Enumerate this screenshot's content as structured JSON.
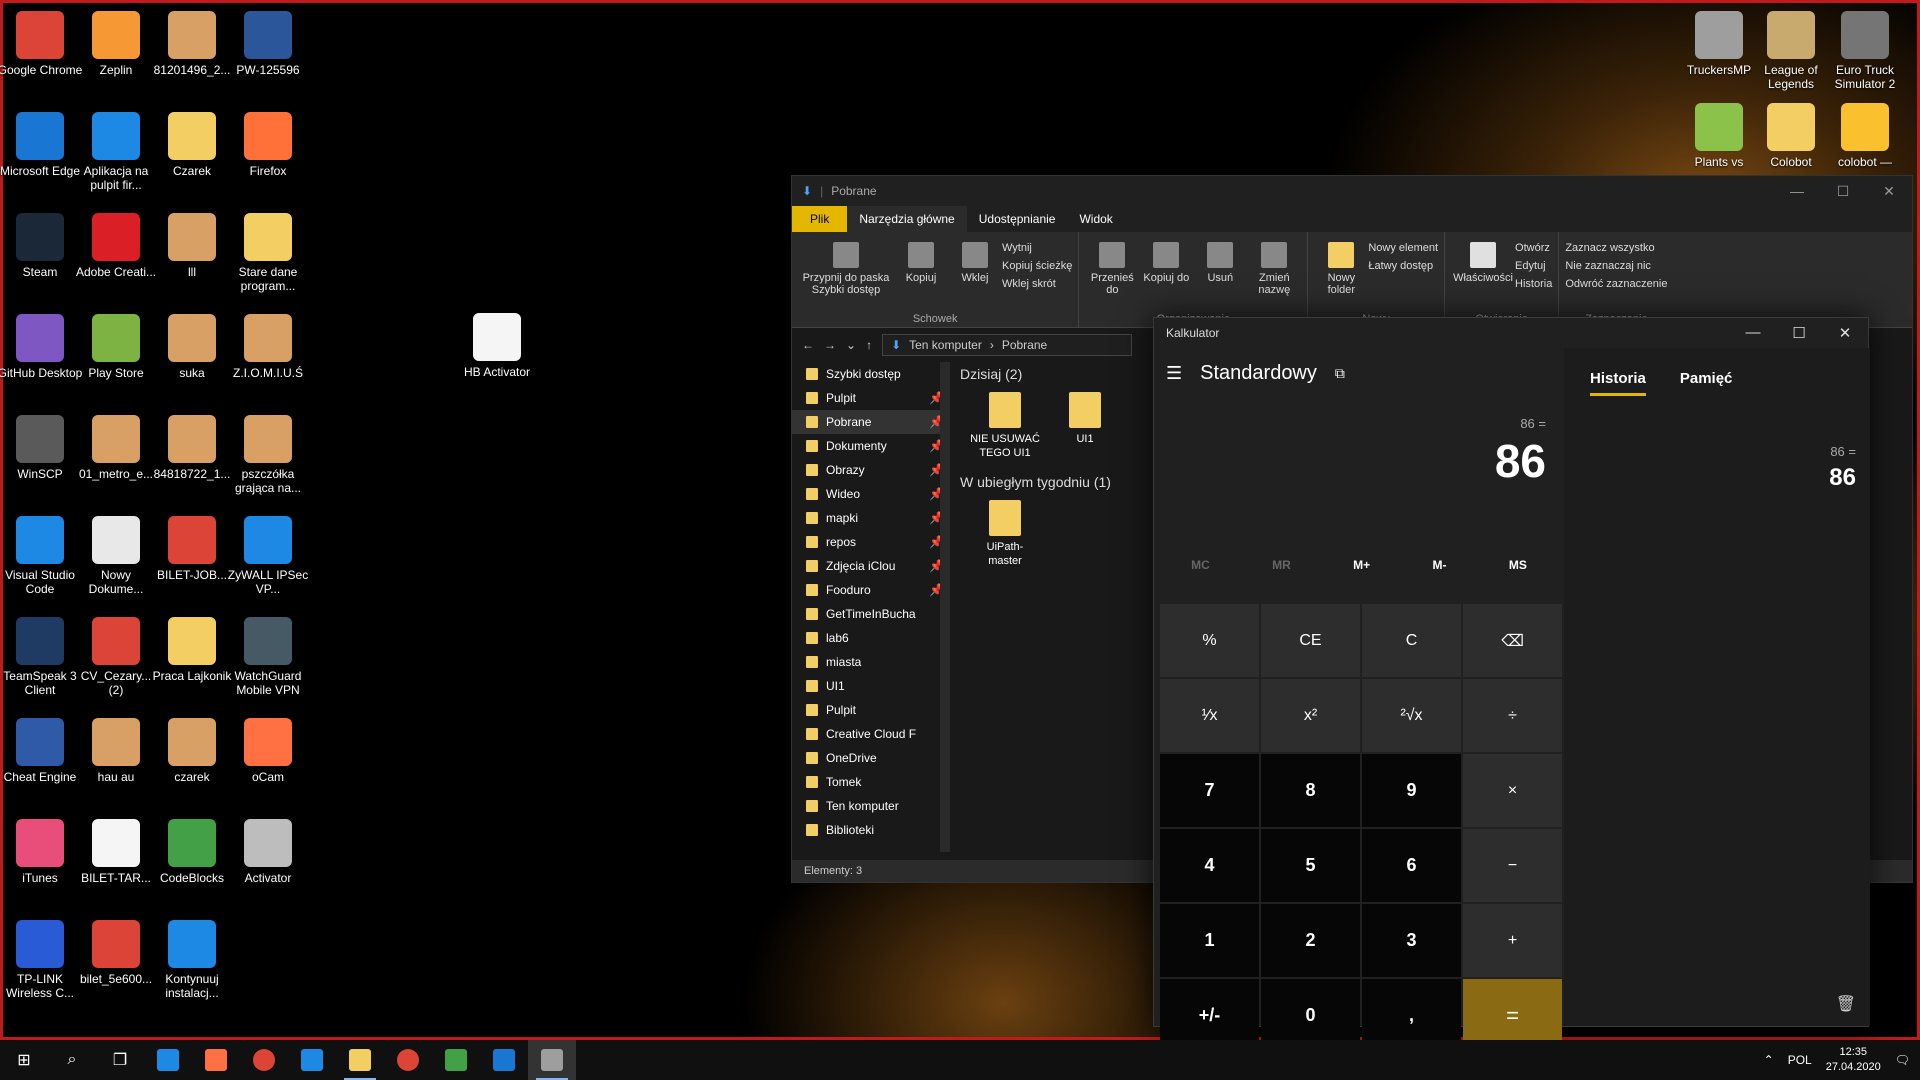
{
  "desktop": {
    "icons": [
      {
        "label": "Google Chrome",
        "icon": "chrome-icon",
        "color": "#db4437"
      },
      {
        "label": "Microsoft Edge",
        "icon": "edge-icon",
        "color": "#1976d2"
      },
      {
        "label": "Steam",
        "icon": "steam-icon",
        "color": "#1b2838"
      },
      {
        "label": "GitHub Desktop",
        "icon": "github-icon",
        "color": "#7e57c2"
      },
      {
        "label": "WinSCP",
        "icon": "winscp-icon",
        "color": "#5a5a5a"
      },
      {
        "label": "Visual Studio Code",
        "icon": "vscode-icon",
        "color": "#1e88e5"
      },
      {
        "label": "TeamSpeak 3 Client",
        "icon": "teamspeak-icon",
        "color": "#1f3b63"
      },
      {
        "label": "Cheat Engine",
        "icon": "cheatengine-icon",
        "color": "#2e5aa8"
      },
      {
        "label": "iTunes",
        "icon": "itunes-icon",
        "color": "#e94d7a"
      },
      {
        "label": "TP-LINK Wireless C...",
        "icon": "tplink-icon",
        "color": "#2a5bd7"
      },
      {
        "label": "Zeplin",
        "icon": "zeplin-icon",
        "color": "#f69833"
      },
      {
        "label": "Aplikacja na pulpit fir...",
        "icon": "app-icon",
        "color": "#1e88e5"
      },
      {
        "label": "Adobe Creati...",
        "icon": "adobe-icon",
        "color": "#da1f26"
      },
      {
        "label": "Play Store",
        "icon": "playstore-icon",
        "color": "#7cb342"
      },
      {
        "label": "01_metro_e...",
        "icon": "image-icon",
        "color": "#d9a066"
      },
      {
        "label": "Nowy Dokume...",
        "icon": "document-icon",
        "color": "#e8e8e8"
      },
      {
        "label": "CV_Cezary... (2)",
        "icon": "chrome-icon",
        "color": "#db4437"
      },
      {
        "label": "hau au",
        "icon": "image-icon",
        "color": "#d9a066"
      },
      {
        "label": "BILET-TAR...",
        "icon": "file-icon",
        "color": "#f5f5f5"
      },
      {
        "label": "bilet_5e600...",
        "icon": "chrome-icon",
        "color": "#db4437"
      },
      {
        "label": "81201496_2...",
        "icon": "image-icon",
        "color": "#d9a066"
      },
      {
        "label": "Czarek",
        "icon": "folder-icon",
        "color": "#f3cf63"
      },
      {
        "label": "lll",
        "icon": "image-icon",
        "color": "#d9a066"
      },
      {
        "label": "suka",
        "icon": "image-icon",
        "color": "#d9a066"
      },
      {
        "label": "84818722_1...",
        "icon": "image-icon",
        "color": "#d9a066"
      },
      {
        "label": "BILET-JOB...",
        "icon": "chrome-icon",
        "color": "#db4437"
      },
      {
        "label": "Praca Lajkonik",
        "icon": "folder-icon",
        "color": "#f3cf63"
      },
      {
        "label": "czarek",
        "icon": "image-icon",
        "color": "#d9a066"
      },
      {
        "label": "CodeBlocks",
        "icon": "codeblocks-icon",
        "color": "#43a047"
      },
      {
        "label": "Kontynuuj instalacj...",
        "icon": "installer-icon",
        "color": "#1e88e5"
      },
      {
        "label": "PW-125596",
        "icon": "word-icon",
        "color": "#2b579a"
      },
      {
        "label": "Firefox",
        "icon": "firefox-icon",
        "color": "#ff7139"
      },
      {
        "label": "Stare dane program...",
        "icon": "folder-icon",
        "color": "#f3cf63"
      },
      {
        "label": "Z.I.O.M.I.U.Ś",
        "icon": "image-icon",
        "color": "#d9a066"
      },
      {
        "label": "pszczółka grająca na...",
        "icon": "image-icon",
        "color": "#d9a066"
      },
      {
        "label": "ZyWALL IPSec VP...",
        "icon": "zywall-icon",
        "color": "#1e88e5"
      },
      {
        "label": "WatchGuard Mobile VPN",
        "icon": "vpn-icon",
        "color": "#455a64"
      },
      {
        "label": "oCam",
        "icon": "ocam-icon",
        "color": "#ff7043"
      },
      {
        "label": "Activator",
        "icon": "activator-icon",
        "color": "#bdbdbd"
      },
      {
        "label": "HB Activator",
        "icon": "file-icon",
        "color": "#f5f5f5"
      },
      {
        "label": "TruckersMP",
        "icon": "truckersmp-icon",
        "color": "#9e9e9e"
      },
      {
        "label": "League of Legends",
        "icon": "lol-icon",
        "color": "#c8aa6e"
      },
      {
        "label": "Euro Truck Simulator 2",
        "icon": "ets2-icon",
        "color": "#757575"
      },
      {
        "label": "Plants vs",
        "icon": "pvz-icon",
        "color": "#8bc34a"
      },
      {
        "label": "Colobot",
        "icon": "folder-icon",
        "color": "#f3cf63"
      },
      {
        "label": "colobot —",
        "icon": "colobot-icon",
        "color": "#fbc02d"
      }
    ]
  },
  "explorer": {
    "title": "Pobrane",
    "tabs": [
      "Plik",
      "Narzędzia główne",
      "Udostępnianie",
      "Widok"
    ],
    "ribbon": {
      "schowek": {
        "name": "Schowek",
        "pin": "Przypnij do paska Szybki dostęp",
        "copy": "Kopiuj",
        "paste": "Wklej",
        "cut": "Wytnij",
        "copy_path": "Kopiuj ścieżkę",
        "paste_shortcut": "Wklej skrót"
      },
      "organizowanie": {
        "name": "Organizowanie",
        "move": "Przenieś do",
        "copy_to": "Kopiuj do",
        "delete": "Usuń",
        "rename": "Zmień nazwę"
      },
      "nowy": {
        "name": "Nowy",
        "new_folder": "Nowy folder",
        "new_item": "Nowy element",
        "easy_access": "Łatwy dostęp"
      },
      "otwieranie": {
        "name": "Otwieranie",
        "properties": "Właściwości",
        "open": "Otwórz",
        "edit": "Edytuj",
        "history": "Historia"
      },
      "zaznaczanie": {
        "name": "Zaznaczanie",
        "select_all": "Zaznacz wszystko",
        "select_none": "Nie zaznaczaj nic",
        "invert": "Odwróć zaznaczenie"
      }
    },
    "address": {
      "root": "Ten komputer",
      "current": "Pobrane"
    },
    "nav": [
      {
        "label": "Szybki dostęp",
        "pin": ""
      },
      {
        "label": "Pulpit",
        "pin": "📌"
      },
      {
        "label": "Pobrane",
        "pin": "📌"
      },
      {
        "label": "Dokumenty",
        "pin": "📌"
      },
      {
        "label": "Obrazy",
        "pin": "📌"
      },
      {
        "label": "Wideo",
        "pin": "📌"
      },
      {
        "label": "mapki",
        "pin": "📌"
      },
      {
        "label": "repos",
        "pin": "📌"
      },
      {
        "label": "Zdjęcia iClou",
        "pin": "📌"
      },
      {
        "label": "Fooduro",
        "pin": "📌"
      },
      {
        "label": "GetTimeInBucha",
        "pin": ""
      },
      {
        "label": "lab6",
        "pin": ""
      },
      {
        "label": "miasta",
        "pin": ""
      },
      {
        "label": "UI1",
        "pin": ""
      },
      {
        "label": "Pulpit",
        "pin": ""
      },
      {
        "label": "Creative Cloud F",
        "pin": ""
      },
      {
        "label": "OneDrive",
        "pin": ""
      },
      {
        "label": "Tomek",
        "pin": ""
      },
      {
        "label": "Ten komputer",
        "pin": ""
      },
      {
        "label": "Biblioteki",
        "pin": ""
      }
    ],
    "groups": [
      {
        "header": "Dzisiaj (2)",
        "items": [
          "NIE USUWAĆ TEGO UI1",
          "UI1"
        ]
      },
      {
        "header": "W ubiegłym tygodniu (1)",
        "items": [
          "UiPath-master"
        ]
      }
    ],
    "status": "Elementy: 3"
  },
  "calculator": {
    "title": "Kalkulator",
    "mode": "Standardowy",
    "expression": "86 =",
    "display": "86",
    "memory": [
      "MC",
      "MR",
      "M+",
      "M-",
      "MS"
    ],
    "keys": [
      "%",
      "CE",
      "C",
      "⌫",
      "¹⁄x",
      "x²",
      "²√x",
      "÷",
      "7",
      "8",
      "9",
      "×",
      "4",
      "5",
      "6",
      "−",
      "1",
      "2",
      "3",
      "+",
      "+/-",
      "0",
      ",",
      "="
    ],
    "tabs": {
      "history": "Historia",
      "memory": "Pamięć"
    },
    "history": {
      "expression": "86 =",
      "value": "86"
    }
  },
  "taskbar": {
    "language": "POL",
    "time": "12:35",
    "date": "27.04.2020"
  }
}
